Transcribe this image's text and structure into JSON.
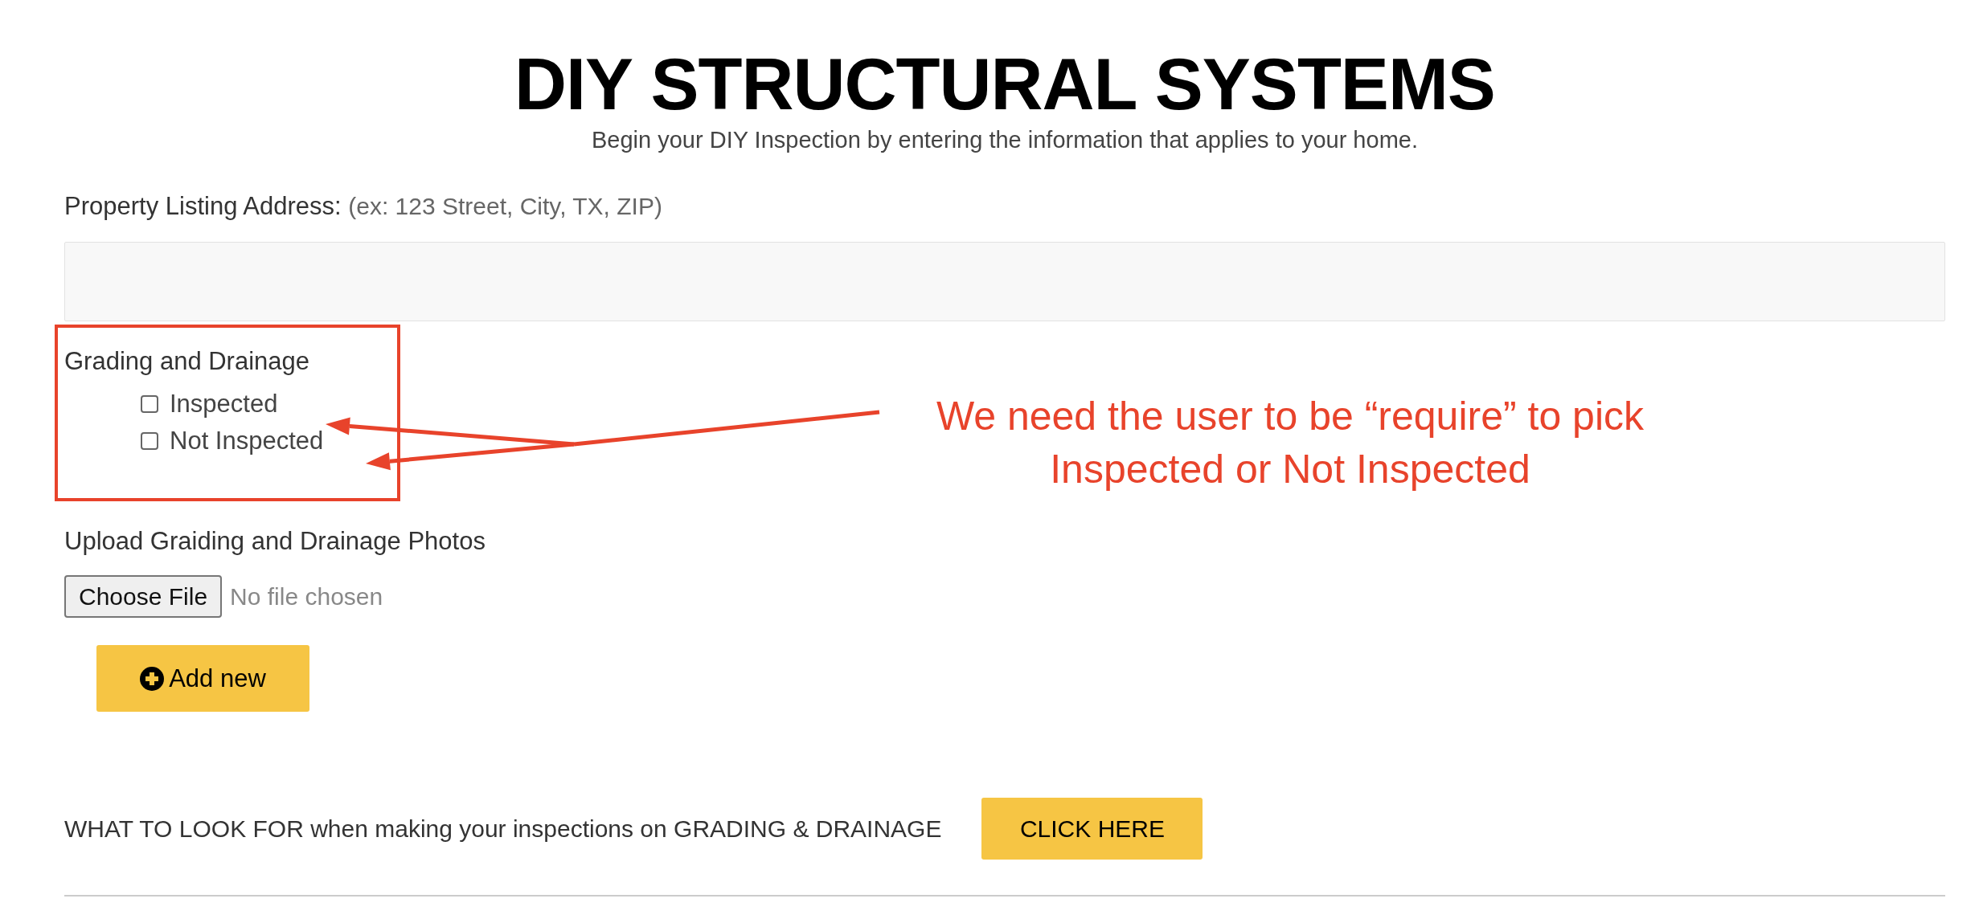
{
  "title": "DIY STRUCTURAL SYSTEMS",
  "subtitle": "Begin your DIY Inspection by entering the information that applies to your home.",
  "address": {
    "label": "Property Listing Address:",
    "hint": "(ex: 123 Street, City, TX, ZIP)"
  },
  "grading": {
    "label": "Grading and Drainage",
    "options": [
      {
        "label": "Inspected",
        "checked": false
      },
      {
        "label": "Not Inspected",
        "checked": false
      }
    ]
  },
  "upload": {
    "label": "Upload Graiding and Drainage Photos",
    "button": "Choose File",
    "status": "No file chosen"
  },
  "add_button": "Add new",
  "footer": {
    "text": "WHAT TO LOOK FOR when making your inspections on GRADING & DRAINAGE",
    "button": "CLICK HERE"
  },
  "annotation": {
    "text": "We need the user to be “require” to pick\nInspected or Not Inspected"
  }
}
